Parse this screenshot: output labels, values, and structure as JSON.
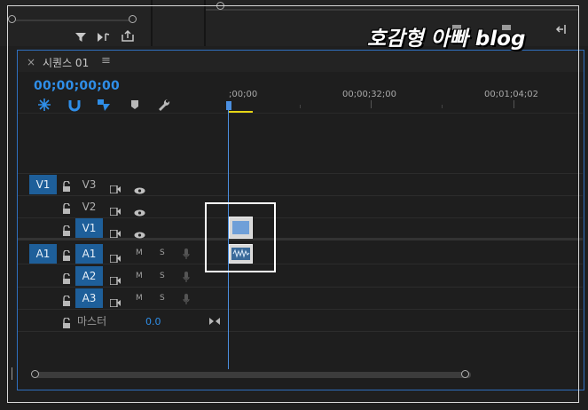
{
  "watermark": {
    "text": "호감형 아빠 blog"
  },
  "sequence": {
    "close_glyph": "×",
    "tab_title": "시퀀스 01",
    "menu_glyph": "≡",
    "timecode": "00;00;00;00"
  },
  "ruler": {
    "labels": [
      ";00;00",
      "00;00;32;00",
      "00;01;04;02"
    ]
  },
  "tracks": {
    "video": [
      {
        "target": "V1",
        "name": "V3",
        "selected": false
      },
      {
        "target": "",
        "name": "V2",
        "selected": false
      },
      {
        "target": "",
        "name": "V1",
        "selected": true
      }
    ],
    "audio": [
      {
        "target": "A1",
        "name": "A1",
        "m": "M",
        "s": "S"
      },
      {
        "target": "",
        "name": "A2",
        "m": "M",
        "s": "S"
      },
      {
        "target": "",
        "name": "A3",
        "m": "M",
        "s": "S"
      }
    ],
    "master": {
      "label": "마스터",
      "volume": "0.0"
    }
  },
  "colors": {
    "accent": "#2f8ee8",
    "target_bg": "#1e5f9a",
    "in_out_bar": "#e6d515",
    "panel_border": "#2f6fbf"
  },
  "icons": {
    "filter": "filter-icon",
    "snap": "snap-magnet-icon",
    "linked": "linked-selection-icon",
    "marker": "marker-icon",
    "settings": "wrench-icon"
  }
}
